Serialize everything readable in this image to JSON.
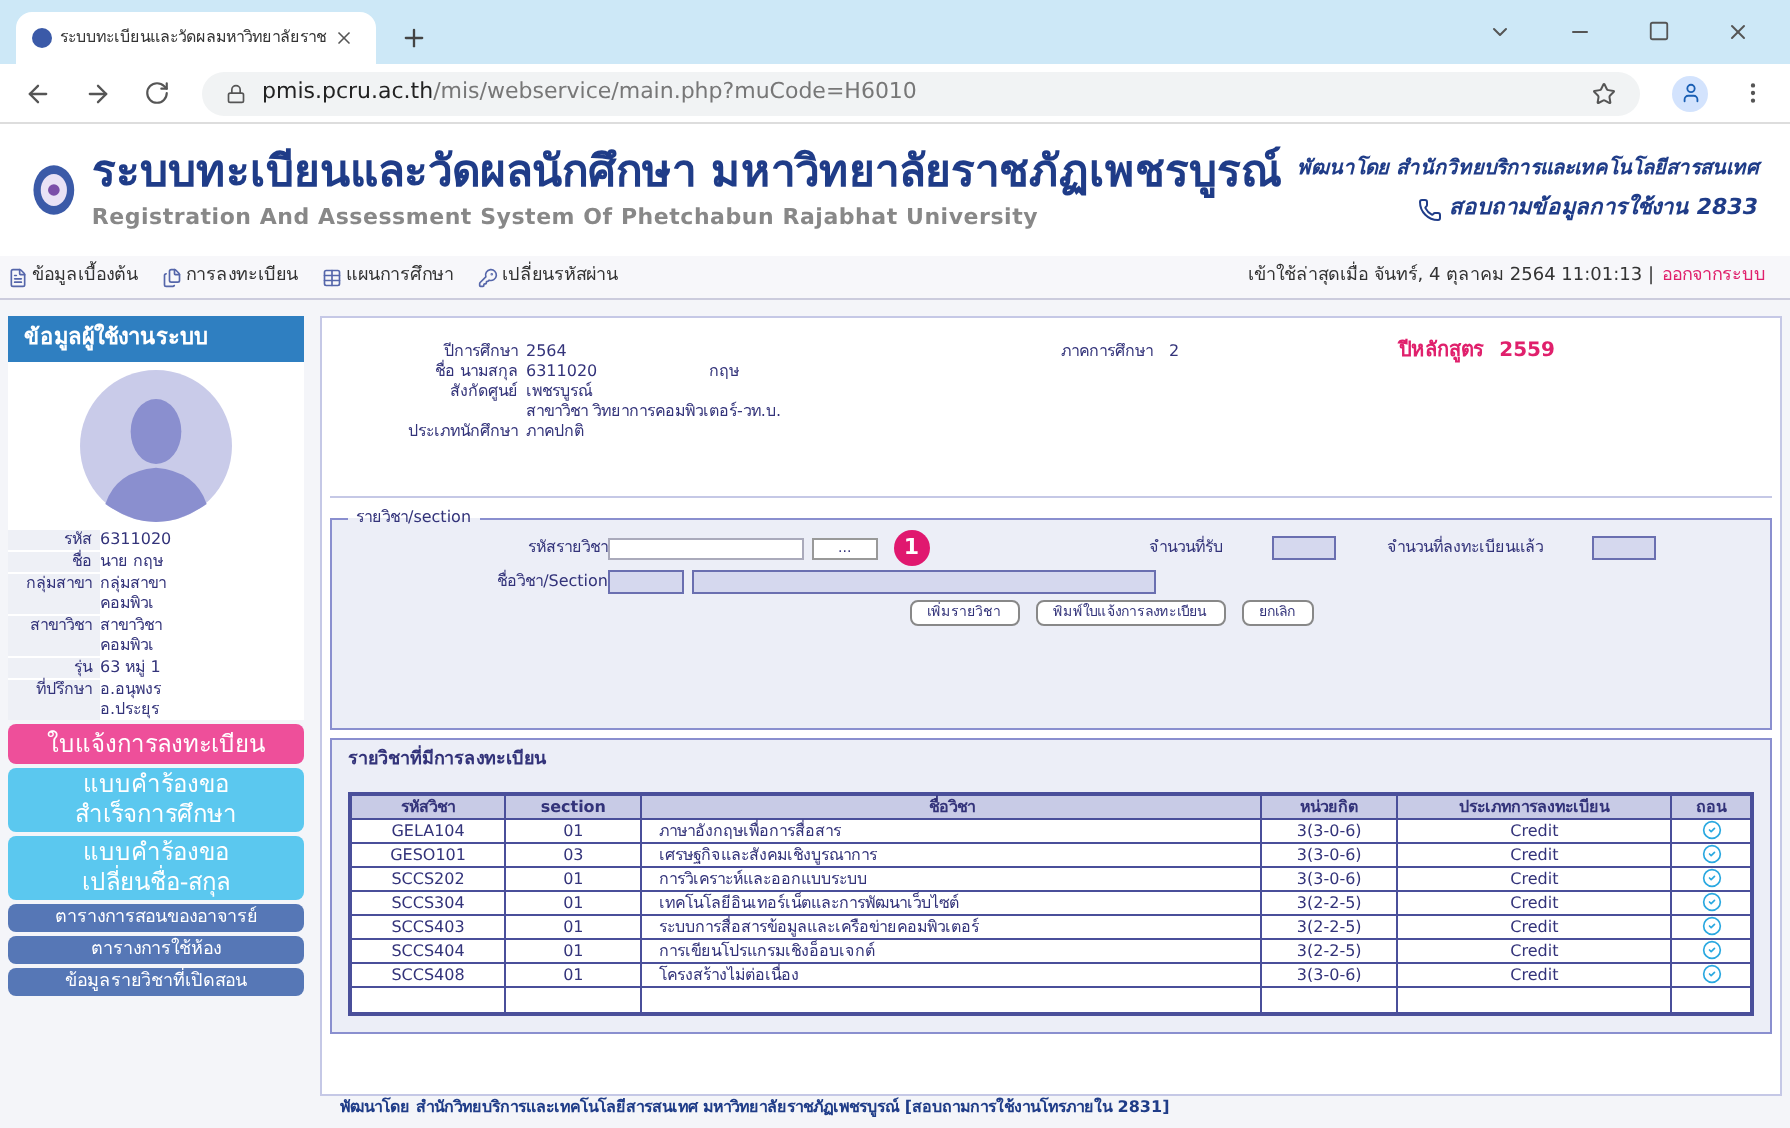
{
  "browser": {
    "tab_title": "ระบบทะเบียนและวัดผลมหาวิทยาลัยราช",
    "url_host": "pmis.pcru.ac.th",
    "url_path": "/mis/webservice/main.php?muCode=H6010"
  },
  "header": {
    "title": "ระบบทะเบียนและวัดผลนักศึกษา มหาวิทยาลัยราชภัฏเพชรบูรณ์",
    "subtitle": "Registration And Assessment System Of Phetchabun Rajabhat University",
    "developer": "พัฒนาโดย สำนักวิทยบริการและเทคโนโลยีสารสนเทศ",
    "contact": "สอบถามข้อมูลการใช้งาน 2833"
  },
  "menu": [
    {
      "kind": "info",
      "label": "ข้อมูลเบื้องต้น"
    },
    {
      "kind": "register",
      "label": "การลงทะเบียน"
    },
    {
      "kind": "plan",
      "label": "แผนการศึกษา"
    },
    {
      "kind": "password",
      "label": "เปลี่ยนรหัสผ่าน"
    }
  ],
  "last_login": "เข้าใช้ล่าสุดเมื่อ จันทร์, 4 ตุลาคม 2564 11:01:13 |",
  "logout": "ออกจากระบบ",
  "sidebar": {
    "title": "ข้อมูลผู้ใช้งานระบบ",
    "info": [
      {
        "label": "รหัส",
        "lines": [
          "6311020"
        ]
      },
      {
        "label": "ชื่อ",
        "lines": [
          "นาย กฤษ"
        ]
      },
      {
        "label": "กลุ่มสาขา",
        "lines": [
          "กลุ่มสาขา",
          "คอมพิวเ"
        ]
      },
      {
        "label": "สาขาวิชา",
        "lines": [
          "สาขาวิชา",
          "คอมพิวเ"
        ]
      },
      {
        "label": "รุ่น",
        "lines": [
          "63 หมู่ 1"
        ]
      },
      {
        "label": "ที่ปรึกษา",
        "lines": [
          "อ.อนุพงร",
          "อ.ประยุร"
        ]
      }
    ],
    "buttons": [
      {
        "kind": "primary",
        "lines": [
          "ใบแจ้งการลงทะเบียน"
        ]
      },
      {
        "kind": "form",
        "lines": [
          "แบบคำร้องขอ",
          "สำเร็จการศึกษา"
        ]
      },
      {
        "kind": "form",
        "lines": [
          "แบบคำร้องขอ",
          "เปลี่ยนชื่อ-สกุล"
        ]
      },
      {
        "kind": "link",
        "lines": [
          "ตารางการสอนของอาจารย์"
        ]
      },
      {
        "kind": "link",
        "lines": [
          "ตารางการใช้ห้อง"
        ]
      },
      {
        "kind": "link",
        "lines": [
          "ข้อมูลรายวิชาที่เปิดสอน"
        ]
      }
    ]
  },
  "student": {
    "fields": [
      {
        "label": "ปีการศึกษา",
        "value": "2564"
      },
      {
        "label": "ชื่อ นามสกุล",
        "value": "6311020",
        "extra": "กฤษ"
      },
      {
        "label": "สังกัดศูนย์",
        "value": "เพชรบูรณ์"
      },
      {
        "value": "สาขาวิชา วิทยาการคอมพิวเตอร์-วท.บ."
      },
      {
        "label": "ประเภทนักศึกษา",
        "value": "ภาคปกติ"
      }
    ],
    "semester_label": "ภาคการศึกษา",
    "semester": "2",
    "curriculum_label": "ปีหลักสูตร",
    "curriculum": "2559"
  },
  "section_form": {
    "legend": "รายวิชา/section",
    "code_label": "รหัสรายวิชา",
    "browse": "...",
    "badge": "1",
    "name_label": "ชื่อวิชา/Section",
    "seats_label": "จำนวนที่รับ",
    "registered_label": "จำนวนที่ลงทะเบียนแล้ว",
    "buttons": [
      "เพิ่มรายวิชา",
      "พิมพ์ใบแจ้งการลงทะเบียน",
      "ยกเลิก"
    ]
  },
  "registered": {
    "title": "รายวิชาที่มีการลงทะเบียน",
    "columns": [
      "รหัสวิชา",
      "section",
      "ชื่อวิชา",
      "หน่วยกิต",
      "ประเภทการลงทะเบียน",
      "ถอน"
    ],
    "rows": [
      [
        "GELA104",
        "01",
        "ภาษาอังกฤษเพื่อการสื่อสาร",
        "3(3-0-6)",
        "Credit"
      ],
      [
        "GESO101",
        "03",
        "เศรษฐกิจและสังคมเชิงบูรณาการ",
        "3(3-0-6)",
        "Credit"
      ],
      [
        "SCCS202",
        "01",
        "การวิเคราะห์และออกแบบระบบ",
        "3(3-0-6)",
        "Credit"
      ],
      [
        "SCCS304",
        "01",
        "เทคโนโลยีอินเทอร์เน็ตและการพัฒนาเว็บไซต์",
        "3(2-2-5)",
        "Credit"
      ],
      [
        "SCCS403",
        "01",
        "ระบบการสื่อสารข้อมูลและเครือข่ายคอมพิวเตอร์",
        "3(2-2-5)",
        "Credit"
      ],
      [
        "SCCS404",
        "01",
        "การเขียนโปรแกรมเชิงอ็อบเจกต์",
        "3(2-2-5)",
        "Credit"
      ],
      [
        "SCCS408",
        "01",
        "โครงสร้างไม่ต่อเนื่อง",
        "3(3-0-6)",
        "Credit"
      ]
    ]
  },
  "footer": "พัฒนาโดย สำนักวิทยบริการและเทคโนโลยีสารสนเทศ มหาวิทยาลัยราชภัฏเพชรบูรณ์ [สอบถามการใช้งานโทรภายใน 2831]"
}
